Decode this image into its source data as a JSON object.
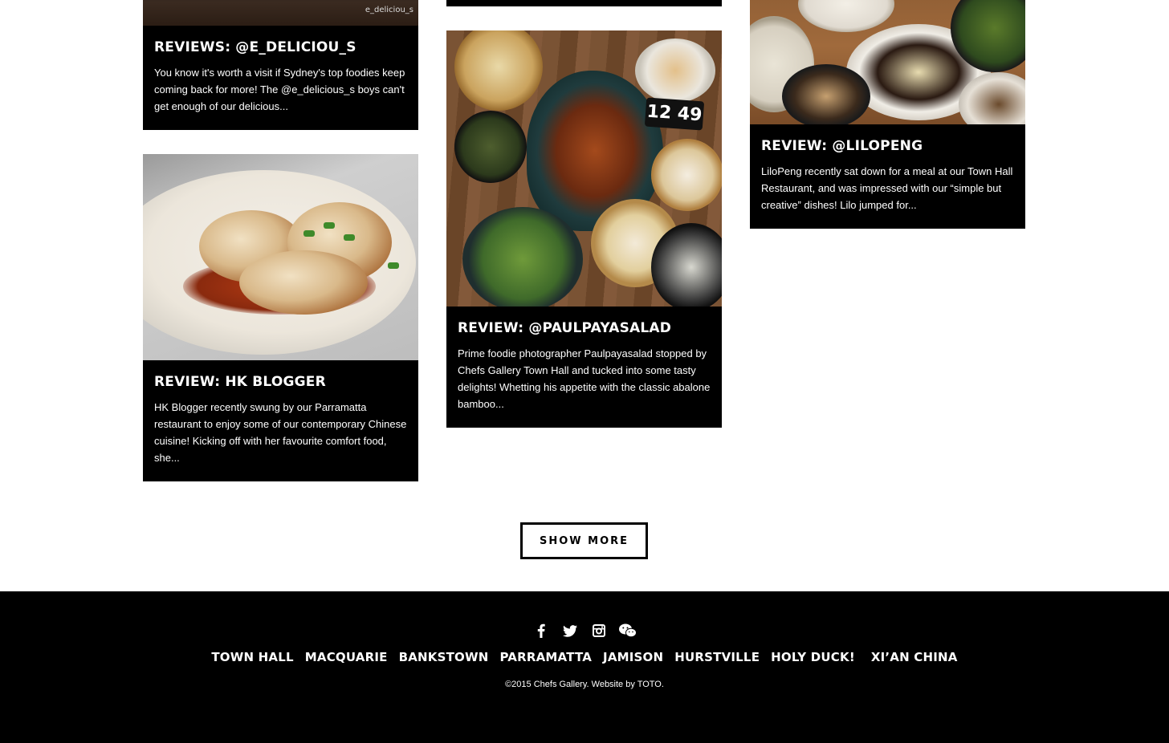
{
  "cards": [
    {
      "title": "REVIEWS: @E_DELICIOU_S",
      "excerpt": "You know it's worth a visit if Sydney's top foodies keep coming back for more! The @e_delicious_s boys can't get enough of our delicious...",
      "image_watermark": "e_deliciou_s"
    },
    {
      "title": "REVIEW: HK BLOGGER",
      "excerpt": "HK Blogger recently swung by our Parramatta restaurant to enjoy some of our contemporary Chinese cuisine! Kicking off with her favourite comfort food, she..."
    },
    {
      "title": "REVIEW: @PAULPAYASALAD",
      "excerpt": "Prime foodie photographer Paulpayasalad stopped by Chefs Gallery Town Hall and tucked into some tasty delights! Whetting his appetite with the classic abalone bamboo...",
      "image_clock": "12 49"
    },
    {
      "title": "REVIEW: @LILOPENG",
      "excerpt": "LiloPeng recently sat down for a meal at our Town Hall Restaurant, and was impressed with our “simple but creative” dishes! Lilo jumped for..."
    }
  ],
  "show_more_label": "SHOW MORE",
  "footer": {
    "socials": [
      "facebook-icon",
      "twitter-icon",
      "instagram-icon",
      "wechat-icon"
    ],
    "locations": [
      "TOWN HALL",
      "MACQUARIE",
      "BANKSTOWN",
      "PARRAMATTA",
      "JAMISON",
      "HURSTVILLE",
      "HOLY DUCK!",
      "XI’AN CHINA"
    ],
    "copyright": "©2015 Chefs Gallery. Website by TOTO."
  }
}
